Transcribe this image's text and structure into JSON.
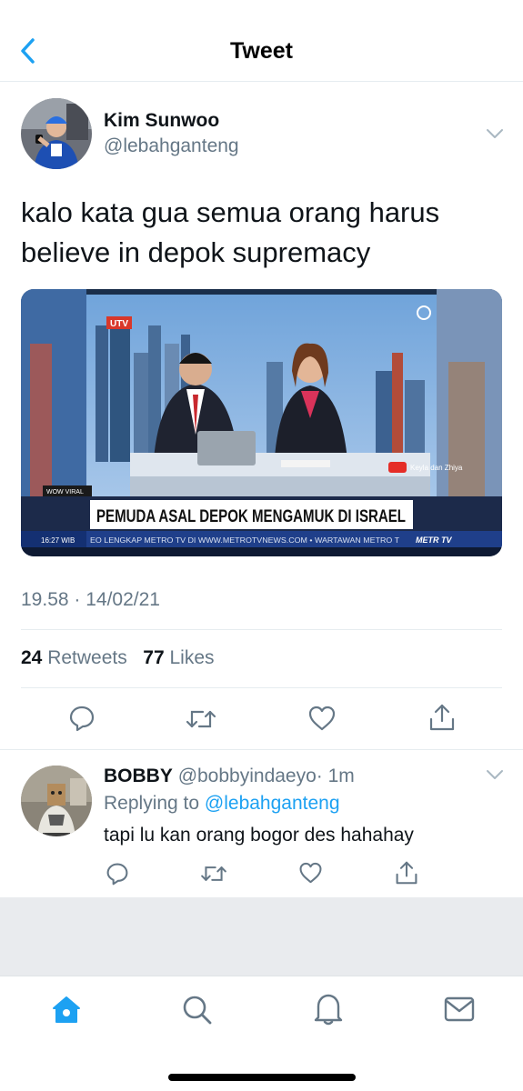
{
  "header": {
    "title": "Tweet",
    "back_icon": "chevron-left-icon"
  },
  "colors": {
    "accent": "#1da1f2",
    "secondary_text": "#657786",
    "primary_text": "#0f1419",
    "divider": "#e6ecf0"
  },
  "tweet": {
    "author_name": "Kim Sunwoo",
    "author_handle": "@lebahganteng",
    "text": "kalo kata gua semua orang harus believe in depok supremacy",
    "media": {
      "logo_left": "UTV",
      "badge": "WOW VIRAL",
      "headline": "PEMUDA ASAL DEPOK MENGAMUK DI ISRAEL",
      "clock": "16:27 WIB",
      "ticker": "EO LENGKAP METRO TV DI WWW.METROTVNEWS.COM • WARTAWAN METRO T",
      "channel": "METR TV",
      "youtube_credit": "Keyla dan Zhiya"
    },
    "timestamp": "19.58 · 14/02/21",
    "retweets_count": "24",
    "retweets_label": "Retweets",
    "likes_count": "77",
    "likes_label": "Likes",
    "actions": [
      "reply-icon",
      "retweet-icon",
      "like-icon",
      "share-icon"
    ]
  },
  "reply": {
    "author_name": "BOBBY",
    "author_handle": "@bobbyindaeyo",
    "time": "· 1m",
    "replying_prefix": "Replying to",
    "replying_to": "@lebahganteng",
    "text": "tapi lu kan orang bogor des hahahay",
    "actions": [
      "reply-icon",
      "retweet-icon",
      "like-icon",
      "share-icon"
    ]
  },
  "tabbar": {
    "items": [
      "home-icon",
      "search-icon",
      "notifications-icon",
      "messages-icon"
    ],
    "active": "home-icon"
  }
}
